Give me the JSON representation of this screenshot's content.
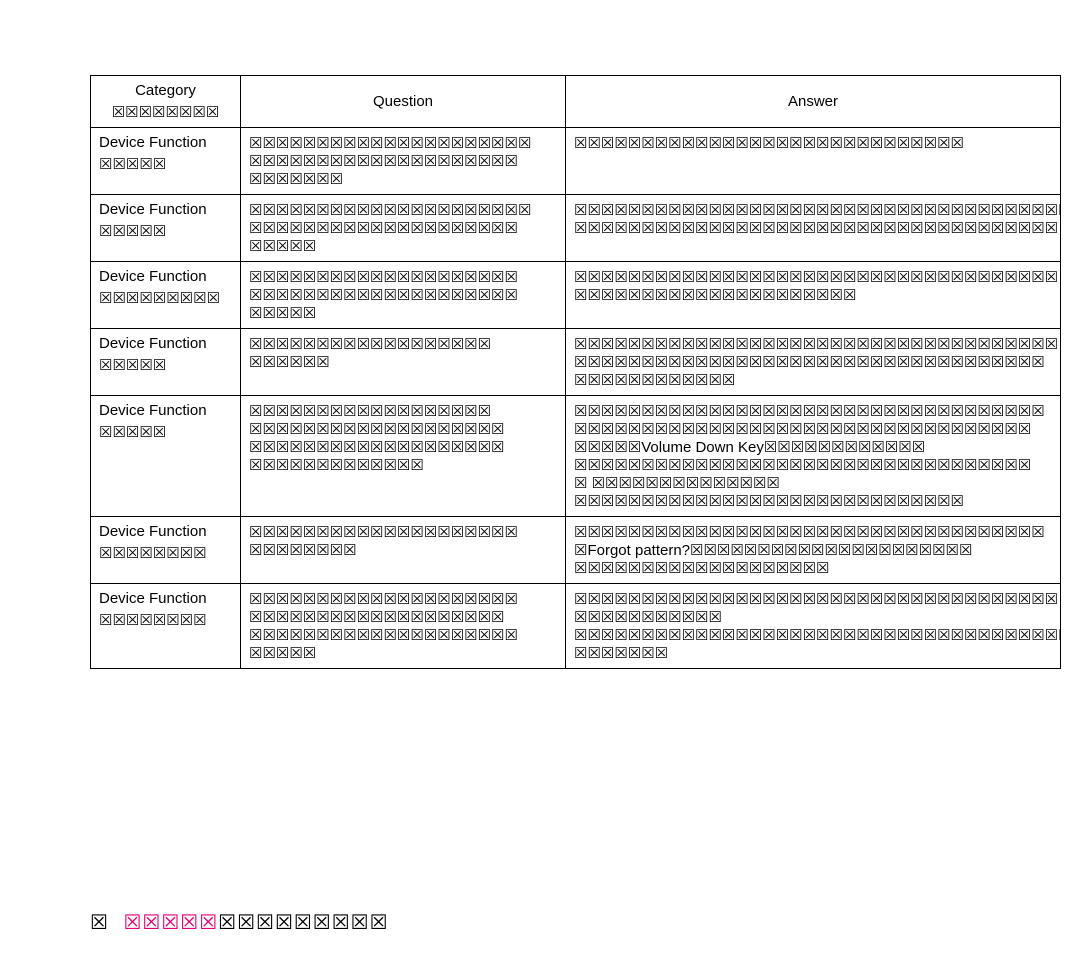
{
  "headers": {
    "category": "Category",
    "sub": "☒☒☒☒☒☒☒☒",
    "question": "Question",
    "answer": "Answer"
  },
  "rows": [
    {
      "cat_main": "Device Function",
      "cat_sub": "☒☒☒☒☒",
      "question": "☒☒☒☒☒☒☒☒☒☒☒☒☒☒☒☒☒☒☒☒☒\n☒☒☒☒☒☒☒☒☒☒☒☒☒☒☒☒☒☒☒☒\n☒☒☒☒☒☒☒",
      "answer": "☒☒☒☒☒☒☒☒☒☒☒☒☒☒☒☒☒☒☒☒☒☒☒☒☒☒☒☒☒"
    },
    {
      "cat_main": "Device Function",
      "cat_sub": "☒☒☒☒☒",
      "question": "☒☒☒☒☒☒☒☒☒☒☒☒☒☒☒☒☒☒☒☒☒\n☒☒☒☒☒☒☒☒☒☒☒☒☒☒☒☒☒☒☒☒\n☒☒☒☒☒",
      "answer": "☒☒☒☒☒☒☒☒☒☒☒☒☒☒☒☒☒☒☒☒☒☒☒☒☒☒☒☒☒☒☒☒☒☒☒☒☒\n☒☒☒☒☒☒☒☒☒☒☒☒☒☒☒☒☒☒☒☒☒☒☒☒☒☒☒☒☒☒☒☒☒☒☒☒"
    },
    {
      "cat_main": "Device Function",
      "cat_sub": "☒☒☒☒☒☒☒☒☒",
      "question": "☒☒☒☒☒☒☒☒☒☒☒☒☒☒☒☒☒☒☒☒\n☒☒☒☒☒☒☒☒☒☒☒☒☒☒☒☒☒☒☒☒\n☒☒☒☒☒",
      "answer": "☒☒☒☒☒☒☒☒☒☒☒☒☒☒☒☒☒☒☒☒☒☒☒☒☒☒☒☒☒☒☒☒☒☒☒☒\n☒☒☒☒☒☒☒☒☒☒☒☒☒☒☒☒☒☒☒☒☒"
    },
    {
      "cat_main": "Device Function",
      "cat_sub": "☒☒☒☒☒",
      "question": "☒☒☒☒☒☒☒☒☒☒☒☒☒☒☒☒☒☒\n☒☒☒☒☒☒",
      "answer": "☒☒☒☒☒☒☒☒☒☒☒☒☒☒☒☒☒☒☒☒☒☒☒☒☒☒☒☒☒☒☒☒☒☒☒☒\n☒☒☒☒☒☒☒☒☒☒☒☒☒☒☒☒☒☒☒☒☒☒☒☒☒☒☒☒☒☒☒☒☒☒☒\n☒☒☒☒☒☒☒☒☒☒☒☒"
    },
    {
      "cat_main": "Device Function",
      "cat_sub": "☒☒☒☒☒",
      "question": "☒☒☒☒☒☒☒☒☒☒☒☒☒☒☒☒☒☒\n☒☒☒☒☒☒☒☒☒☒☒☒☒☒☒☒☒☒☒\n☒☒☒☒☒☒☒☒☒☒☒☒☒☒☒☒☒☒☒\n☒☒☒☒☒☒☒☒☒☒☒☒☒",
      "answer_parts": [
        "☒☒☒☒☒☒☒☒☒☒☒☒☒☒☒☒☒☒☒☒☒☒☒☒☒☒☒☒☒☒☒☒☒☒☒",
        "☒☒☒☒☒☒☒☒☒☒☒☒☒☒☒☒☒☒☒☒☒☒☒☒☒☒☒☒☒☒☒☒☒☒",
        {
          "prefix": "☒☒☒☒☒ ",
          "bold": "Volume Down Key",
          "suffix": "☒☒☒☒☒☒☒☒☒☒☒☒"
        },
        "☒☒☒☒☒☒☒☒☒☒☒☒☒☒☒☒☒☒☒☒☒☒☒☒☒☒☒☒☒☒☒☒☒☒",
        "☒ ☒☒☒☒☒☒☒☒☒☒☒☒☒☒",
        "☒☒☒☒☒☒☒☒☒☒☒☒☒☒☒☒☒☒☒☒☒☒☒☒☒☒☒☒☒"
      ]
    },
    {
      "cat_main": "Device Function",
      "cat_sub": "☒☒☒☒☒☒☒☒",
      "question": "☒☒☒☒☒☒☒☒☒☒☒☒☒☒☒☒☒☒☒☒\n☒☒☒☒☒☒☒☒",
      "answer_parts": [
        "☒☒☒☒☒☒☒☒☒☒☒☒☒☒☒☒☒☒☒☒☒☒☒☒☒☒☒☒☒☒☒☒☒☒☒",
        {
          "prefix": "☒ ",
          "bold": "Forgot pattern?",
          "suffix": " ☒☒☒☒☒☒☒☒☒☒☒☒☒☒☒☒☒☒☒☒☒"
        },
        "☒☒☒☒☒☒☒☒☒☒☒☒☒☒☒☒☒☒☒"
      ]
    },
    {
      "cat_main": "Device Function",
      "cat_sub": "☒☒☒☒☒☒☒☒",
      "question": "☒☒☒☒☒☒☒☒☒☒☒☒☒☒☒☒☒☒☒☒\n☒☒☒☒☒☒☒☒☒☒☒☒☒☒☒☒☒☒☒\n☒☒☒☒☒☒☒☒☒☒☒☒☒☒☒☒☒☒☒☒\n☒☒☒☒☒",
      "answer": "☒☒☒☒☒☒☒☒☒☒☒☒☒☒☒☒☒☒☒☒☒☒☒☒☒☒☒☒☒☒☒☒☒☒☒☒\n☒☒☒☒☒☒☒☒☒☒☒\n☒☒☒☒☒☒☒☒☒☒☒☒☒☒☒☒☒☒☒☒☒☒☒☒☒☒☒☒☒☒☒☒☒☒☒☒☒\n☒☒☒☒☒☒☒"
    }
  ],
  "footer": {
    "glyph": "☒",
    "pink": "☒☒☒☒☒",
    "rest": "☒☒☒☒☒☒☒☒☒"
  }
}
